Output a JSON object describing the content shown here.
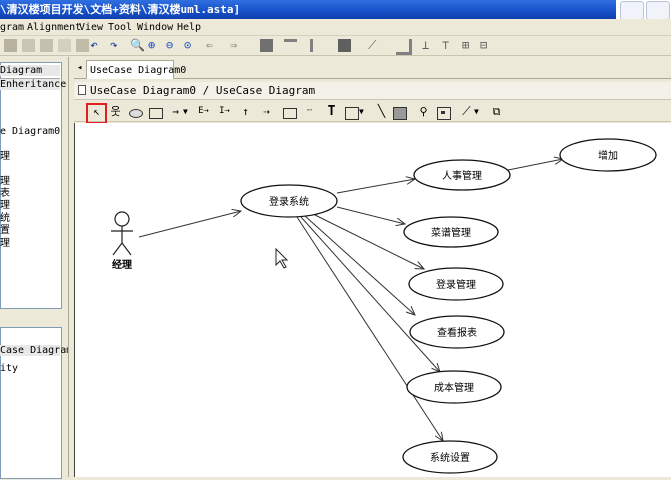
{
  "window": {
    "title": "\\清汉楼项目开发\\文档+资料\\清汉楼uml.asta]"
  },
  "menu": [
    "gram",
    "Alignment",
    "View",
    "Tool",
    "Window",
    "Help"
  ],
  "left_panel": {
    "top_tabs": [
      "Diagram",
      "Enheritance"
    ],
    "tree_items": [
      "e Diagram0",
      "理",
      "理",
      "表",
      "理",
      "统",
      "置",
      "理"
    ],
    "bottom_tab": "Case Diagram0",
    "bottom_item": "ity"
  },
  "editor": {
    "tab_label": "UseCase Diagram0",
    "diagram_path": "UseCase Diagram0 / UseCase Diagram"
  },
  "diagram": {
    "actor": "经理",
    "nodes": {
      "login_system": "登录系统",
      "hr": "人事管理",
      "add": "增加",
      "menu_mgmt": "菜谱管理",
      "login_mgmt": "登录管理",
      "report": "查看报表",
      "cost": "成本管理",
      "settings": "系统设置"
    }
  },
  "colors": {
    "titlebar": "#1750c8",
    "selected_tool_border": "#e02020",
    "canvas": "#ffffff"
  }
}
